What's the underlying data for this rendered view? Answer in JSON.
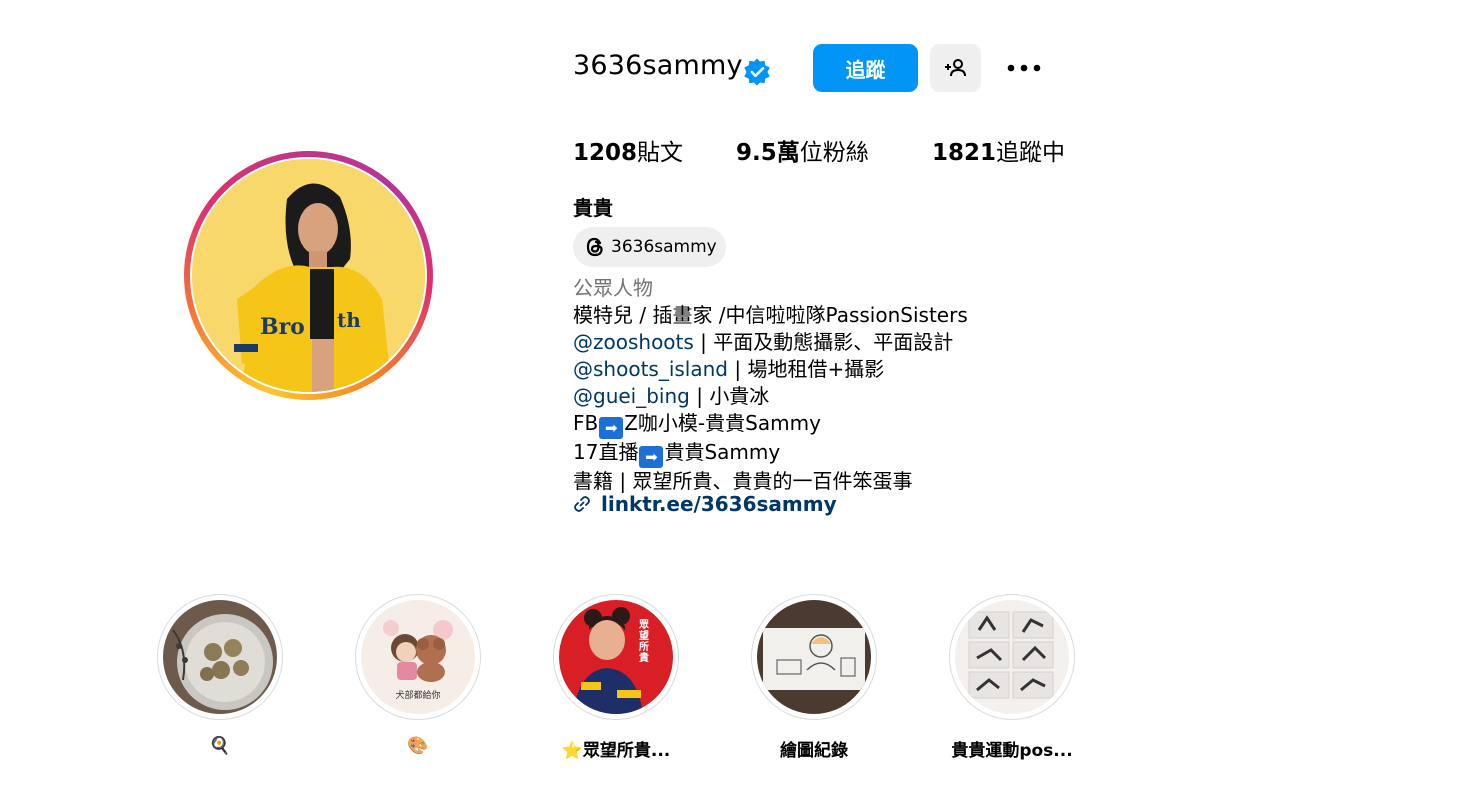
{
  "profile": {
    "username": "3636sammy",
    "follow_label": "追蹤",
    "stats": {
      "posts_value": "1208",
      "posts_label": "貼文",
      "followers_value": "9.5萬",
      "followers_label": "位粉絲",
      "following_value": "1821",
      "following_label": "追蹤中"
    },
    "full_name": "貴貴",
    "threads_handle": "3636sammy",
    "category": "公眾人物",
    "bio": {
      "line1": "模特兒 / 插畫家 /中信啦啦隊PassionSisters",
      "line2_mention": "@zooshoots",
      "line2_text": " | 平面及動態攝影、平面設計",
      "line3_mention": "@shoots_island",
      "line3_text": " | 場地租借+攝影",
      "line4_mention": "@guei_bing",
      "line4_text": " | 小貴冰",
      "line5_pre": "FB",
      "line5_post": "Z咖小模-貴貴Sammy",
      "line6_pre": "17直播",
      "line6_post": "貴貴Sammy",
      "line7": "書籍 | 眾望所貴、貴貴的一百件笨蛋事",
      "arrow_glyph": "➡"
    },
    "link": "linktr.ee/3636sammy"
  },
  "highlights": [
    {
      "label": "🍳"
    },
    {
      "label": "🎨"
    },
    {
      "label": "⭐眾望所貴..."
    },
    {
      "label": "繪圖紀錄"
    },
    {
      "label": "貴貴運動pos..."
    }
  ],
  "highlight_pic_texts": {
    "dog_caption": "犬部都給你",
    "book_title": "眾望所貴"
  },
  "colors": {
    "accent": "#0095f6",
    "link": "#00376b",
    "verified": "#0095f6",
    "secondary_text": "#737373"
  }
}
